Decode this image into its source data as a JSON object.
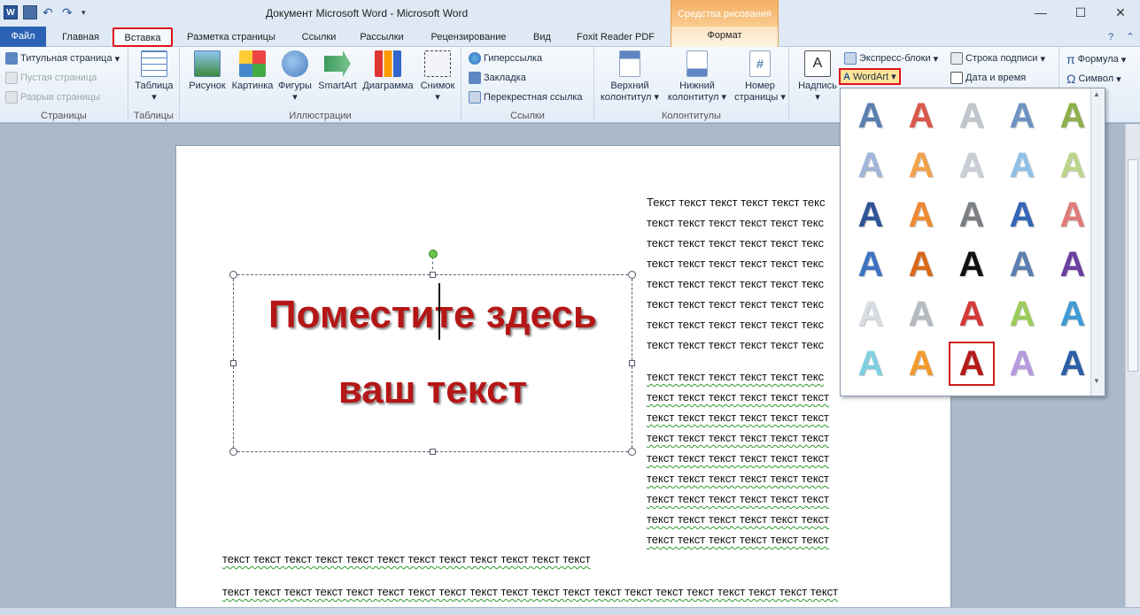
{
  "window": {
    "title": "Документ Microsoft Word  -  Microsoft Word",
    "context_tab_group": "Средства рисования"
  },
  "tabs": [
    {
      "label": "Файл"
    },
    {
      "label": "Главная"
    },
    {
      "label": "Вставка"
    },
    {
      "label": "Разметка страницы"
    },
    {
      "label": "Ссылки"
    },
    {
      "label": "Рассылки"
    },
    {
      "label": "Рецензирование"
    },
    {
      "label": "Вид"
    },
    {
      "label": "Foxit Reader PDF"
    },
    {
      "label": "Формат"
    }
  ],
  "ribbon": {
    "pages": {
      "label": "Страницы",
      "items": [
        "Титульная страница",
        "Пустая страница",
        "Разрыв страницы"
      ]
    },
    "tables": {
      "label": "Таблицы",
      "button": "Таблица"
    },
    "illustrations": {
      "label": "Иллюстрации",
      "buttons": [
        "Рисунок",
        "Картинка",
        "Фигуры",
        "SmartArt",
        "Диаграмма",
        "Снимок"
      ]
    },
    "links": {
      "label": "Ссылки",
      "items": [
        "Гиперссылка",
        "Закладка",
        "Перекрестная ссылка"
      ]
    },
    "headers": {
      "label": "Колонтитулы",
      "buttons": [
        "Верхний колонтитул",
        "Нижний колонтитул",
        "Номер страницы"
      ]
    },
    "text": {
      "inscription": "Надпись",
      "express_blocks": "Экспресс-блоки",
      "wordart": "WordArt",
      "signature_line": "Строка подписи",
      "date_time": "Дата и время"
    },
    "symbols": {
      "formula": "Формула",
      "symbol": "Символ"
    }
  },
  "document": {
    "wordart_lines": [
      "Поместите здесь",
      "ваш текст"
    ],
    "right_column_first": "Текст текст текст текст текст текс",
    "right_column_line": "текст текст текст текст текст текс",
    "right_column_line2": " текст текст текст текст текст текс",
    "right_column_line3": "текст текст текст текст текст текст",
    "full_line_1": "текст текст текст текст текст текст текст текст текст текст текст текст",
    "full_line_2": "текст текст текст текст текст текст текст текст текст текст текст текст текст текст текст текст текст текст текст текст"
  },
  "gallery": {
    "letter": "A",
    "styles": [
      [
        "#5b7fb0",
        "#d9574a",
        "#c0c6cc",
        "#6f92c4",
        "#8db04a"
      ],
      [
        "#9fb6d6",
        "#f3a24c",
        "#c9cfd4",
        "#8fc1e8",
        "#bcd58a"
      ],
      [
        "#2f5597",
        "#ee8a33",
        "#7b7f83",
        "#3566b6",
        "#e07a7a"
      ],
      [
        "#3d73c0",
        "#d96a1a",
        "#111111",
        "#5b7fb0",
        "#6b3fa0"
      ],
      [
        "#d8dde3",
        "#b5bbc2",
        "#d43a3a",
        "#9ccc5a",
        "#3f9ad6"
      ],
      [
        "#7fd0e0",
        "#f29b2c",
        "#b51a1a",
        "#b59ae0",
        "#2a5ea6"
      ]
    ],
    "selected": [
      5,
      2
    ]
  }
}
